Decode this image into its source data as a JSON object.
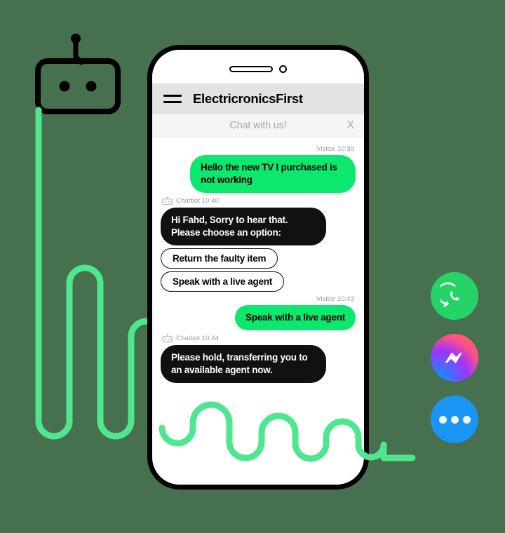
{
  "colors": {
    "background": "#47704f",
    "accent_green": "#0ce86e",
    "wave_green": "#4ee68f",
    "bot_bubble": "#111111",
    "header_bg": "#e3e3e3",
    "subbar_bg": "#f5f5f5",
    "whatsapp": "#25d366",
    "sms_blue": "#1a95f5"
  },
  "decor": {
    "robot_mark_name": "robot-mark-icon"
  },
  "phone": {
    "speaker_name": "phone-speaker",
    "camera_name": "phone-front-camera"
  },
  "header": {
    "menu_label": "Menu",
    "title": "ElectricronicsFirst"
  },
  "chat_bar": {
    "label": "Chat with us!",
    "close_label": "X"
  },
  "conversation": [
    {
      "sender": "visitor",
      "meta": "Visitor 10:39",
      "text": "Hello the new TV I purchased is not working"
    },
    {
      "sender": "chatbot",
      "meta": "Chatbot 10:40",
      "text": "Hi Fahd, Sorry to hear that. Please choose an option:",
      "options": [
        "Return the faulty item",
        "Speak with a live agent"
      ]
    },
    {
      "sender": "visitor",
      "meta": "Visitor 10:43",
      "text": "Speak with a live agent"
    },
    {
      "sender": "chatbot",
      "meta": "Chatbot 10:44",
      "text": "Please hold, transferring you to an available agent now."
    }
  ],
  "channels": [
    {
      "name": "whatsapp",
      "label": "WhatsApp"
    },
    {
      "name": "messenger",
      "label": "Facebook Messenger"
    },
    {
      "name": "sms",
      "label": "SMS Chat"
    }
  ]
}
